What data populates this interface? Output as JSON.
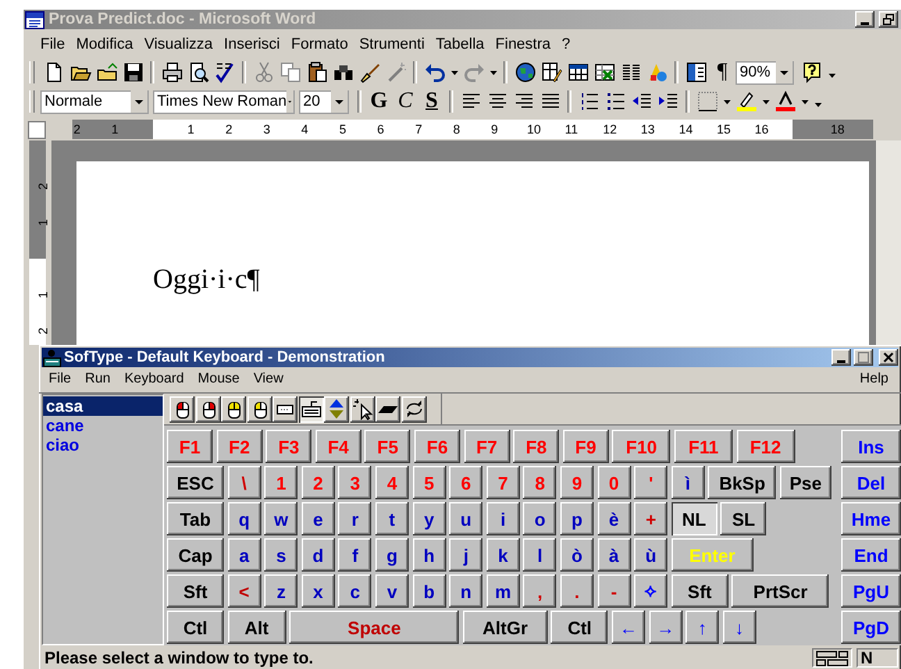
{
  "word": {
    "title": "Prova Predict.doc - Microsoft Word",
    "menu": [
      "File",
      "Modifica",
      "Visualizza",
      "Inserisci",
      "Formato",
      "Strumenti",
      "Tabella",
      "Finestra",
      "?"
    ],
    "standard_toolbar": {
      "show_marks": "¶",
      "zoom": "90%"
    },
    "formatting_toolbar": {
      "style": "Normale",
      "font": "Times New Roman",
      "size": "20",
      "bold": "G",
      "italic": "C",
      "underline": "S"
    },
    "ruler": [
      "2",
      "1",
      "1",
      "2",
      "3",
      "4",
      "5",
      "6",
      "7",
      "8",
      "9",
      "10",
      "11",
      "12",
      "13",
      "14",
      "15",
      "16",
      "18"
    ],
    "vertical_ruler": [
      "2",
      "1",
      "1",
      "2"
    ],
    "document_text": "Oggi·i·c¶"
  },
  "softype": {
    "title": "SofType - Default Keyboard - Demonstration",
    "menu": [
      "File",
      "Run",
      "Keyboard",
      "Mouse",
      "View"
    ],
    "help": "Help",
    "word_list": [
      {
        "text": "casa",
        "selected": true
      },
      {
        "text": "cane",
        "selected": false
      },
      {
        "text": "ciao",
        "selected": false
      }
    ],
    "toolbar": [
      {
        "kind": "left-click",
        "selected": false
      },
      {
        "kind": "right-click",
        "selected": false
      },
      {
        "kind": "double-click",
        "selected": false
      },
      {
        "kind": "hold-click",
        "selected": false
      },
      {
        "kind": "drag",
        "selected": false
      },
      {
        "kind": "keyboard",
        "selected": true
      },
      {
        "kind": "scroll",
        "selected": false
      },
      {
        "kind": "pointer",
        "selected": false
      },
      {
        "kind": "bar",
        "selected": false
      },
      {
        "kind": "repeat",
        "selected": false
      }
    ],
    "keyboard": {
      "rows": [
        {
          "keys": [
            {
              "label": "F1",
              "color": "#ff0000",
              "pressed": false
            },
            {
              "label": "F2",
              "color": "#ff0000",
              "pressed": false
            },
            {
              "label": "F3",
              "color": "#ff0000",
              "pressed": false
            },
            {
              "label": "F4",
              "color": "#ff0000",
              "pressed": false
            },
            {
              "label": "F5",
              "color": "#ff0000",
              "pressed": false
            },
            {
              "label": "F6",
              "color": "#ff0000",
              "pressed": false
            },
            {
              "label": "F7",
              "color": "#ff0000",
              "pressed": false
            },
            {
              "label": "F8",
              "color": "#ff0000",
              "pressed": false
            },
            {
              "label": "F9",
              "color": "#ff0000",
              "pressed": false
            },
            {
              "label": "F10",
              "color": "#ff0000",
              "pressed": false
            },
            {
              "label": "F11",
              "color": "#ff0000",
              "pressed": false
            },
            {
              "label": "F12",
              "color": "#ff0000",
              "pressed": false
            }
          ]
        },
        {
          "keys": [
            {
              "label": "ESC",
              "color": "#000000",
              "pressed": false
            },
            {
              "label": "\\",
              "color": "#d00000",
              "pressed": false
            },
            {
              "label": "1",
              "color": "#ff0000",
              "pressed": false
            },
            {
              "label": "2",
              "color": "#ff0000",
              "pressed": false
            },
            {
              "label": "3",
              "color": "#ff0000",
              "pressed": false
            },
            {
              "label": "4",
              "color": "#ff0000",
              "pressed": false
            },
            {
              "label": "5",
              "color": "#ff0000",
              "pressed": false
            },
            {
              "label": "6",
              "color": "#ff0000",
              "pressed": false
            },
            {
              "label": "7",
              "color": "#ff0000",
              "pressed": false
            },
            {
              "label": "8",
              "color": "#ff0000",
              "pressed": false
            },
            {
              "label": "9",
              "color": "#ff0000",
              "pressed": false
            },
            {
              "label": "0",
              "color": "#ff0000",
              "pressed": false
            },
            {
              "label": "'",
              "color": "#ff0000",
              "pressed": false
            },
            {
              "label": "ì",
              "color": "#0000c0",
              "pressed": false
            },
            {
              "label": "BkSp",
              "color": "#000000",
              "pressed": false
            },
            {
              "label": "Pse",
              "color": "#000000",
              "pressed": false
            }
          ]
        },
        {
          "keys": [
            {
              "label": "Tab",
              "color": "#000000",
              "pressed": false
            },
            {
              "label": "q",
              "color": "#0000c0",
              "pressed": false
            },
            {
              "label": "w",
              "color": "#0000c0",
              "pressed": false
            },
            {
              "label": "e",
              "color": "#0000c0",
              "pressed": false
            },
            {
              "label": "r",
              "color": "#0000c0",
              "pressed": false
            },
            {
              "label": "t",
              "color": "#0000c0",
              "pressed": false
            },
            {
              "label": "y",
              "color": "#0000c0",
              "pressed": false
            },
            {
              "label": "u",
              "color": "#0000c0",
              "pressed": false
            },
            {
              "label": "i",
              "color": "#0000c0",
              "pressed": false
            },
            {
              "label": "o",
              "color": "#0000c0",
              "pressed": false
            },
            {
              "label": "p",
              "color": "#0000c0",
              "pressed": false
            },
            {
              "label": "è",
              "color": "#0000c0",
              "pressed": false
            },
            {
              "label": "+",
              "color": "#d00000",
              "pressed": false
            },
            {
              "label": "NL",
              "color": "#000000",
              "pressed": true
            },
            {
              "label": "SL",
              "color": "#000000",
              "pressed": false
            }
          ]
        },
        {
          "keys": [
            {
              "label": "Cap",
              "color": "#000000",
              "pressed": false
            },
            {
              "label": "a",
              "color": "#0000c0",
              "pressed": false
            },
            {
              "label": "s",
              "color": "#0000c0",
              "pressed": false
            },
            {
              "label": "d",
              "color": "#0000c0",
              "pressed": false
            },
            {
              "label": "f",
              "color": "#0000c0",
              "pressed": false
            },
            {
              "label": "g",
              "color": "#0000c0",
              "pressed": false
            },
            {
              "label": "h",
              "color": "#0000c0",
              "pressed": false
            },
            {
              "label": "j",
              "color": "#0000c0",
              "pressed": false
            },
            {
              "label": "k",
              "color": "#0000c0",
              "pressed": false
            },
            {
              "label": "l",
              "color": "#0000c0",
              "pressed": false
            },
            {
              "label": "ò",
              "color": "#0000c0",
              "pressed": false
            },
            {
              "label": "à",
              "color": "#0000c0",
              "pressed": false
            },
            {
              "label": "ù",
              "color": "#0000c0",
              "pressed": false
            },
            {
              "label": "Enter",
              "color": "#ffff00",
              "pressed": false
            }
          ]
        },
        {
          "keys": [
            {
              "label": "Sft",
              "color": "#000000",
              "pressed": false
            },
            {
              "label": "<",
              "color": "#c00000",
              "pressed": false
            },
            {
              "label": "z",
              "color": "#0000c0",
              "pressed": false
            },
            {
              "label": "x",
              "color": "#0000c0",
              "pressed": false
            },
            {
              "label": "c",
              "color": "#0000c0",
              "pressed": false
            },
            {
              "label": "v",
              "color": "#0000c0",
              "pressed": false
            },
            {
              "label": "b",
              "color": "#0000c0",
              "pressed": false
            },
            {
              "label": "n",
              "color": "#0000c0",
              "pressed": false
            },
            {
              "label": "m",
              "color": "#0000c0",
              "pressed": false
            },
            {
              "label": ",",
              "color": "#d00000",
              "pressed": false
            },
            {
              "label": ".",
              "color": "#d00000",
              "pressed": false
            },
            {
              "label": "-",
              "color": "#d00000",
              "pressed": false
            },
            {
              "label": "⟡",
              "color": "#0000ff",
              "pressed": false
            },
            {
              "label": "Sft",
              "color": "#000000",
              "pressed": false
            },
            {
              "label": "PrtScr",
              "color": "#000000",
              "pressed": false
            }
          ]
        },
        {
          "keys": [
            {
              "label": "Ctl",
              "color": "#000000",
              "pressed": false
            },
            {
              "label": "Alt",
              "color": "#000000",
              "pressed": false
            },
            {
              "label": "Space",
              "color": "#c00000",
              "pressed": false
            },
            {
              "label": "AltGr",
              "color": "#000000",
              "pressed": false
            },
            {
              "label": "Ctl",
              "color": "#000000",
              "pressed": false
            },
            {
              "label": "←",
              "color": "#0000ff",
              "pressed": false
            },
            {
              "label": "→",
              "color": "#0000ff",
              "pressed": false
            },
            {
              "label": "↑",
              "color": "#0000ff",
              "pressed": false
            },
            {
              "label": "↓",
              "color": "#0000ff",
              "pressed": false
            }
          ]
        }
      ],
      "side_keys": [
        {
          "label": "Ins",
          "color": "#0000ff",
          "pressed": false
        },
        {
          "label": "Del",
          "color": "#0000ff",
          "pressed": false
        },
        {
          "label": "Hme",
          "color": "#0000ff",
          "pressed": false
        },
        {
          "label": "End",
          "color": "#0000ff",
          "pressed": false
        },
        {
          "label": "PgU",
          "color": "#0000ff",
          "pressed": false
        },
        {
          "label": "PgD",
          "color": "#0000ff",
          "pressed": false
        }
      ]
    },
    "status": "Please select a window to type to.",
    "mode": "N"
  }
}
